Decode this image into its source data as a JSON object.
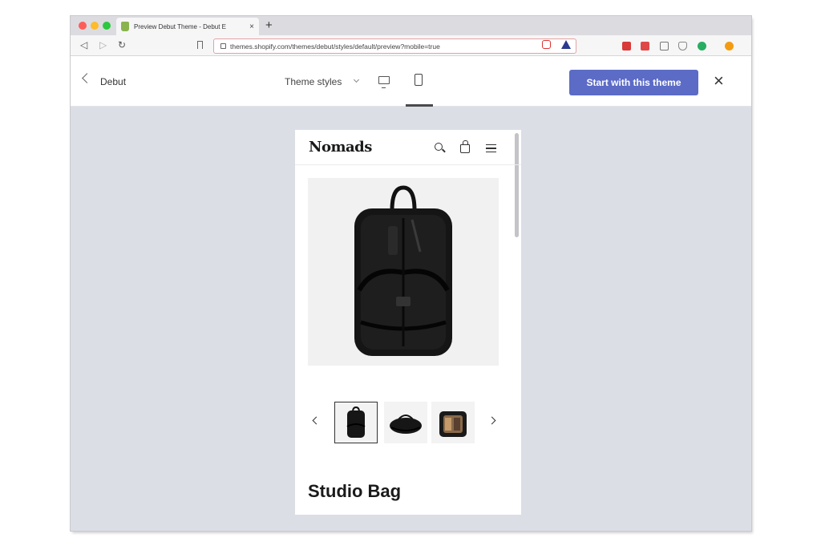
{
  "browser": {
    "tab_title": "Preview Debut Theme - Debut E",
    "tab_close": "×",
    "new_tab": "+",
    "url": "themes.shopify.com/themes/debut/styles/default/preview?mobile=true"
  },
  "preview_bar": {
    "back_label": "Debut",
    "styles_label": "Theme styles",
    "cta_label": "Start with this theme",
    "close_label": "×"
  },
  "store": {
    "brand": "Nomads",
    "product_title": "Studio Bag"
  },
  "icons": [
    "traffic-lights",
    "shopify-favicon",
    "back-arrow-icon",
    "forward-arrow-icon",
    "reload-icon",
    "bookmark-icon",
    "lock-icon",
    "desktop-icon",
    "mobile-icon",
    "search-icon",
    "cart-icon",
    "menu-icon",
    "chevron-left-icon",
    "chevron-right-icon"
  ],
  "colors": {
    "cta": "#5b6bc6",
    "canvas": "#dcdee6"
  }
}
